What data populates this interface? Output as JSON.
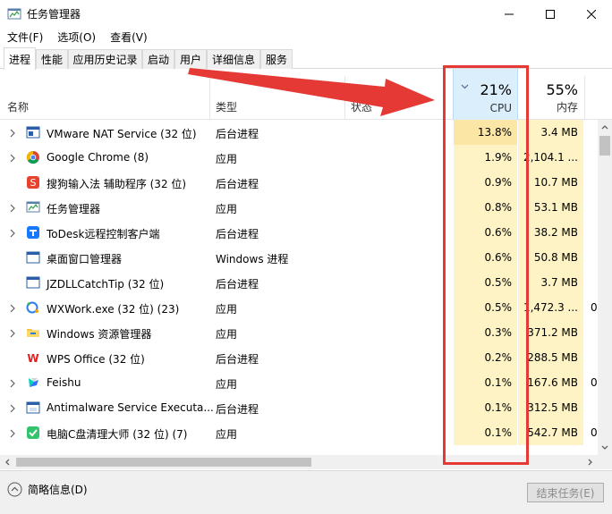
{
  "window": {
    "title": "任务管理器"
  },
  "menu": [
    "文件(F)",
    "选项(O)",
    "查看(V)"
  ],
  "tabs": [
    "进程",
    "性能",
    "应用历史记录",
    "启动",
    "用户",
    "详细信息",
    "服务"
  ],
  "active_tab": 0,
  "columns": {
    "name": "名称",
    "type": "类型",
    "status": "状态",
    "cpu": {
      "label": "CPU",
      "percent": "21%"
    },
    "memory": {
      "label": "内存",
      "percent": "55%"
    }
  },
  "rows": [
    {
      "name": "VMware NAT Service (32 位)",
      "type": "后台进程",
      "cpu": "13.8%",
      "mem": "3.4 MB",
      "extra": "",
      "expand": true,
      "icon": "vmware-window-icon",
      "cpu_level": 3
    },
    {
      "name": "Google Chrome (8)",
      "type": "应用",
      "cpu": "1.9%",
      "mem": "2,104.1 ...",
      "extra": "",
      "expand": true,
      "icon": "chrome-icon",
      "cpu_level": 1
    },
    {
      "name": "搜狗输入法 辅助程序 (32 位)",
      "type": "后台进程",
      "cpu": "0.9%",
      "mem": "10.7 MB",
      "extra": "",
      "expand": false,
      "icon": "sogou-icon",
      "cpu_level": 1
    },
    {
      "name": "任务管理器",
      "type": "应用",
      "cpu": "0.8%",
      "mem": "53.1 MB",
      "extra": "",
      "expand": true,
      "icon": "task-manager-icon",
      "cpu_level": 1
    },
    {
      "name": "ToDesk远程控制客户端",
      "type": "后台进程",
      "cpu": "0.6%",
      "mem": "38.2 MB",
      "extra": "",
      "expand": true,
      "icon": "todesk-icon",
      "cpu_level": 1
    },
    {
      "name": "桌面窗口管理器",
      "type": "Windows 进程",
      "cpu": "0.6%",
      "mem": "50.8 MB",
      "extra": "",
      "expand": false,
      "icon": "dwm-window-icon",
      "cpu_level": 1
    },
    {
      "name": "JZDLLCatchTip (32 位)",
      "type": "后台进程",
      "cpu": "0.5%",
      "mem": "3.7 MB",
      "extra": "",
      "expand": false,
      "icon": "generic-window-icon",
      "cpu_level": 1
    },
    {
      "name": "WXWork.exe (32 位) (23)",
      "type": "应用",
      "cpu": "0.5%",
      "mem": "1,472.3 ...",
      "extra": "0",
      "expand": true,
      "icon": "wxwork-icon",
      "cpu_level": 1
    },
    {
      "name": "Windows 资源管理器",
      "type": "应用",
      "cpu": "0.3%",
      "mem": "371.2 MB",
      "extra": "",
      "expand": true,
      "icon": "explorer-folder-icon",
      "cpu_level": 1
    },
    {
      "name": "WPS Office (32 位)",
      "type": "后台进程",
      "cpu": "0.2%",
      "mem": "288.5 MB",
      "extra": "",
      "expand": false,
      "icon": "wps-icon",
      "cpu_level": 1
    },
    {
      "name": "Feishu",
      "type": "应用",
      "cpu": "0.1%",
      "mem": "167.6 MB",
      "extra": "0",
      "expand": true,
      "icon": "feishu-icon",
      "cpu_level": 1
    },
    {
      "name": "Antimalware Service Executa...",
      "type": "后台进程",
      "cpu": "0.1%",
      "mem": "312.5 MB",
      "extra": "",
      "expand": true,
      "icon": "antimalware-window-icon",
      "cpu_level": 1
    },
    {
      "name": "电脑C盘清理大师 (32 位) (7)",
      "type": "应用",
      "cpu": "0.1%",
      "mem": "542.7 MB",
      "extra": "0",
      "expand": true,
      "icon": "c-drive-cleaner-icon",
      "cpu_level": 1
    }
  ],
  "footer": {
    "fewer_details": "简略信息(D)",
    "end_task": "结束任务(E)"
  },
  "colors": {
    "cpu_high": "#fbe6a6",
    "cpu_low": "#fdf3c4",
    "mem": "#fdf3c4",
    "cpu_header": "#dbeefb",
    "annotation_red": "#e53935"
  }
}
